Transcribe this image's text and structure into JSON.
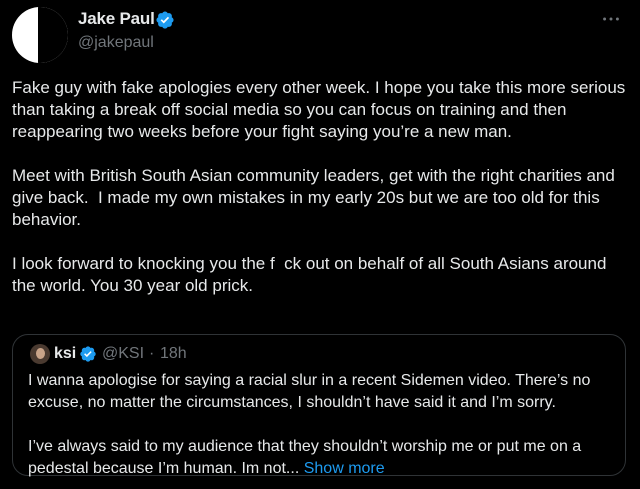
{
  "tweet": {
    "author": {
      "display_name": "Jake Paul",
      "handle": "@jakepaul",
      "verified": true
    },
    "paragraphs": [
      "Fake guy with fake apologies every other week. I hope you take this more serious than taking a break off social media so you can focus on training and then reappearing two weeks before your fight saying you’re a new man.",
      "Meet with British South Asian community leaders, get with the right charities and give back.  I made my own mistakes in my early 20s but we are too old for this behavior.",
      "I look forward to knocking you the f  ck out on behalf of all South Asians around the world. You 30 year old prick."
    ],
    "more_icon": "ellipsis-icon"
  },
  "quote": {
    "author": {
      "display_name": "ksi",
      "handle": "@KSI",
      "separator": "·",
      "time": "18h",
      "verified": true
    },
    "paragraphs": [
      "I wanna apologise for saying a racial slur in a recent Sidemen video. There’s no excuse, no matter the circumstances, I shouldn’t have said it and I’m sorry.",
      "I’ve always said to my audience that they shouldn’t worship me or put me on a pedestal because I’m human. Im not..."
    ],
    "show_more_label": "Show more"
  },
  "colors": {
    "background": "#000000",
    "text_primary": "#e7e9ea",
    "text_secondary": "#71767b",
    "accent": "#1d9bf0",
    "border": "#2f3336"
  }
}
